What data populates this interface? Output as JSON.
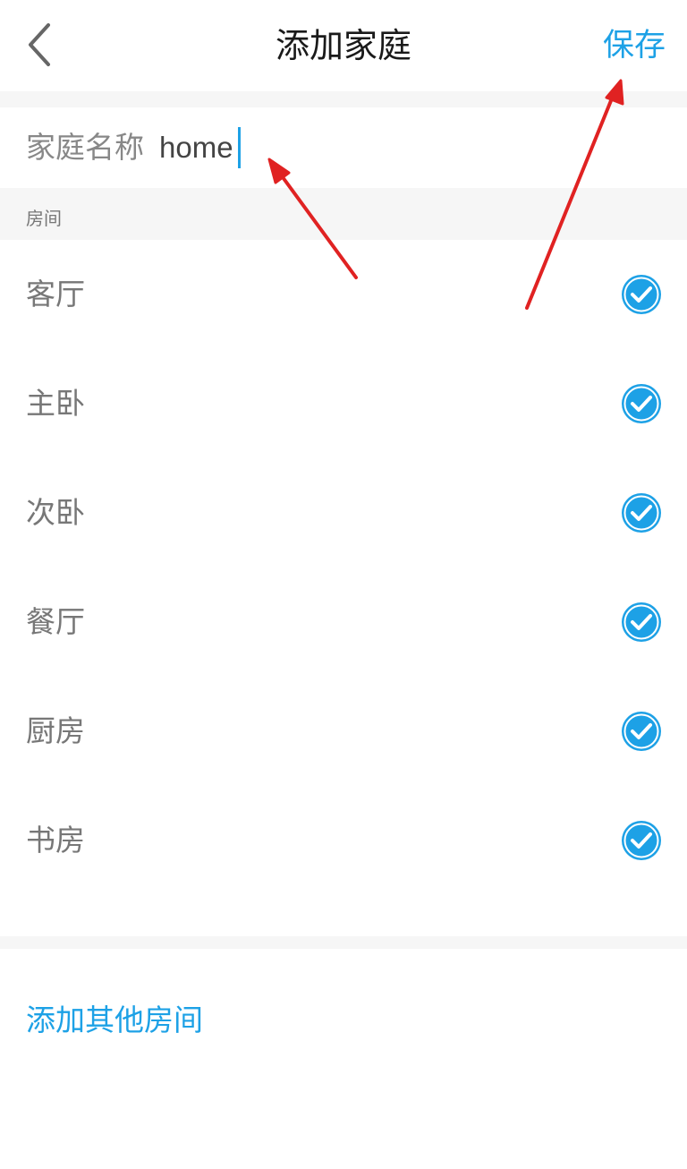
{
  "header": {
    "back_icon": "chevron-left-icon",
    "title": "添加家庭",
    "save_label": "保存"
  },
  "family_name": {
    "label": "家庭名称",
    "value": "home"
  },
  "rooms_section": {
    "label": "房间",
    "rooms": [
      {
        "label": "客厅",
        "checked": true
      },
      {
        "label": "主卧",
        "checked": true
      },
      {
        "label": "次卧",
        "checked": true
      },
      {
        "label": "餐厅",
        "checked": true
      },
      {
        "label": "厨房",
        "checked": true
      },
      {
        "label": "书房",
        "checked": true
      }
    ]
  },
  "add_room_label": "添加其他房间",
  "colors": {
    "accent": "#1da1e6",
    "annotation_arrow": "#e02222"
  }
}
